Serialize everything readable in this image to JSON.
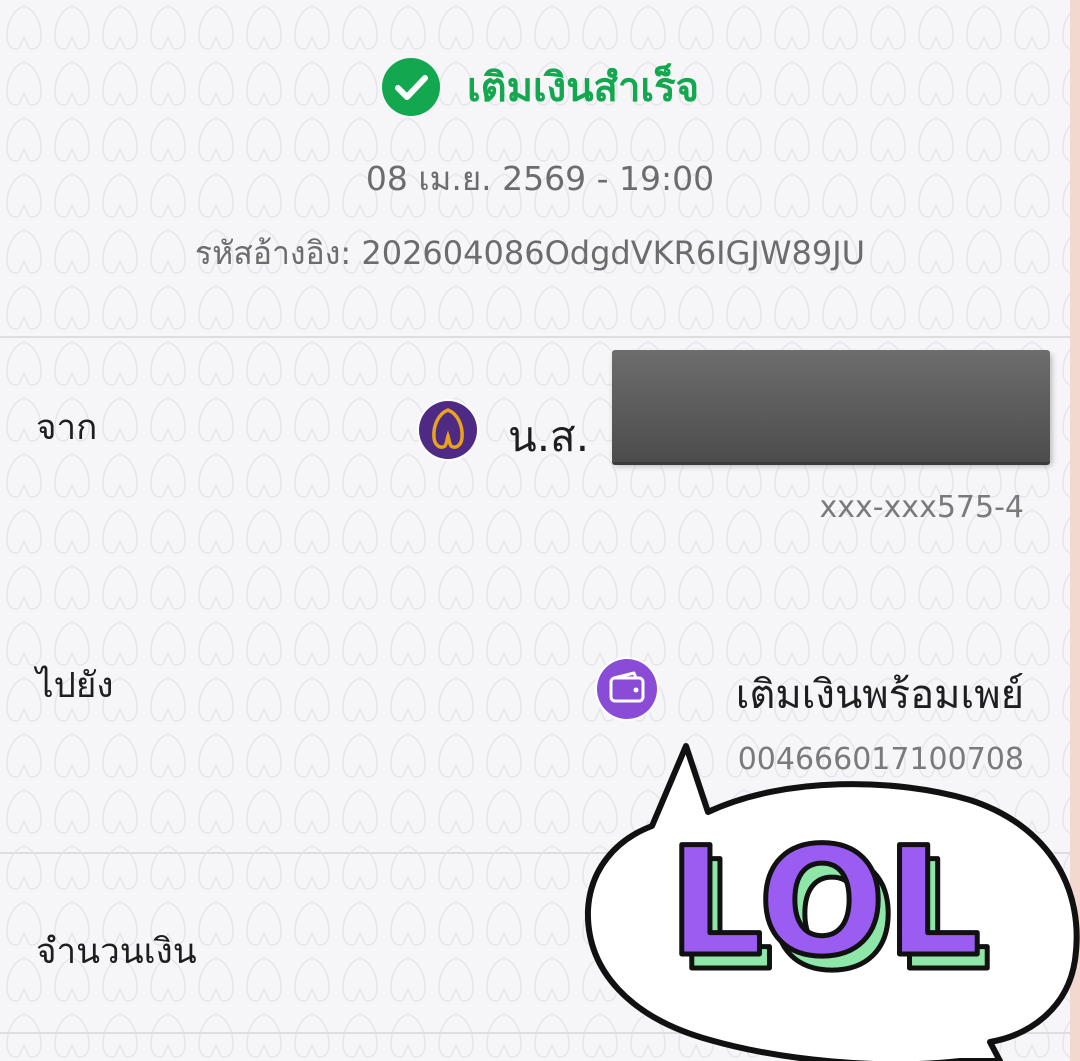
{
  "header": {
    "status_icon": "check-circle-icon",
    "status_text": "เติมเงินสำเร็จ",
    "date_time": "08 เม.ย. 2569 - 19:00",
    "reference": "รหัสอ้างอิง: 202604086OdgdVKR6IGJW89JU"
  },
  "from": {
    "label": "จาก",
    "bank_icon": "bank-logo-icon",
    "name_prefix": "น.ส.",
    "account": "xxx-xxx575-4"
  },
  "to": {
    "label": "ไปยัง",
    "wallet_icon": "wallet-icon",
    "name": "เติมเงินพร้อมเพย์",
    "account": "004666017100708"
  },
  "amount": {
    "label": "จำนวนเงิน"
  },
  "sticker": {
    "text": "LOL"
  },
  "colors": {
    "success_green": "#13a84f",
    "bank_purple": "#4e2a84",
    "bank_gold": "#e8a21c",
    "wallet_purple": "#8a4bd6",
    "sticker_purple": "#9b5cf2",
    "sticker_green": "#8ee6a8"
  }
}
